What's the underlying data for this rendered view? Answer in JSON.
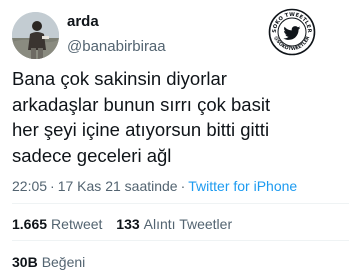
{
  "author": {
    "display_name": "arda",
    "handle": "@banabirbiraa"
  },
  "stamp": {
    "top_text": "SOKO TWEETLER",
    "bottom_text": "@SOKOTWEETLER",
    "icon": "bird-icon",
    "color": "#0f1419"
  },
  "tweet": {
    "text": "Bana çok sakinsin diyorlar\narkadaşlar bunun sırrı çok basit\nher şeyi içine atıyorsun bitti gitti\nsadece geceleri ağl"
  },
  "meta": {
    "time": "22:05",
    "separator": "·",
    "date": "17 Kas 21 saatinde",
    "source": "Twitter for iPhone"
  },
  "stats": {
    "retweets": {
      "count": "1.665",
      "label": "Retweet"
    },
    "quotes": {
      "count": "133",
      "label": "Alıntı Tweetler"
    },
    "likes": {
      "count": "30B",
      "label": "Beğeni"
    }
  },
  "colors": {
    "text": "#0f1419",
    "secondary": "#536471",
    "link": "#1d9bf0",
    "divider": "#eff3f4"
  }
}
